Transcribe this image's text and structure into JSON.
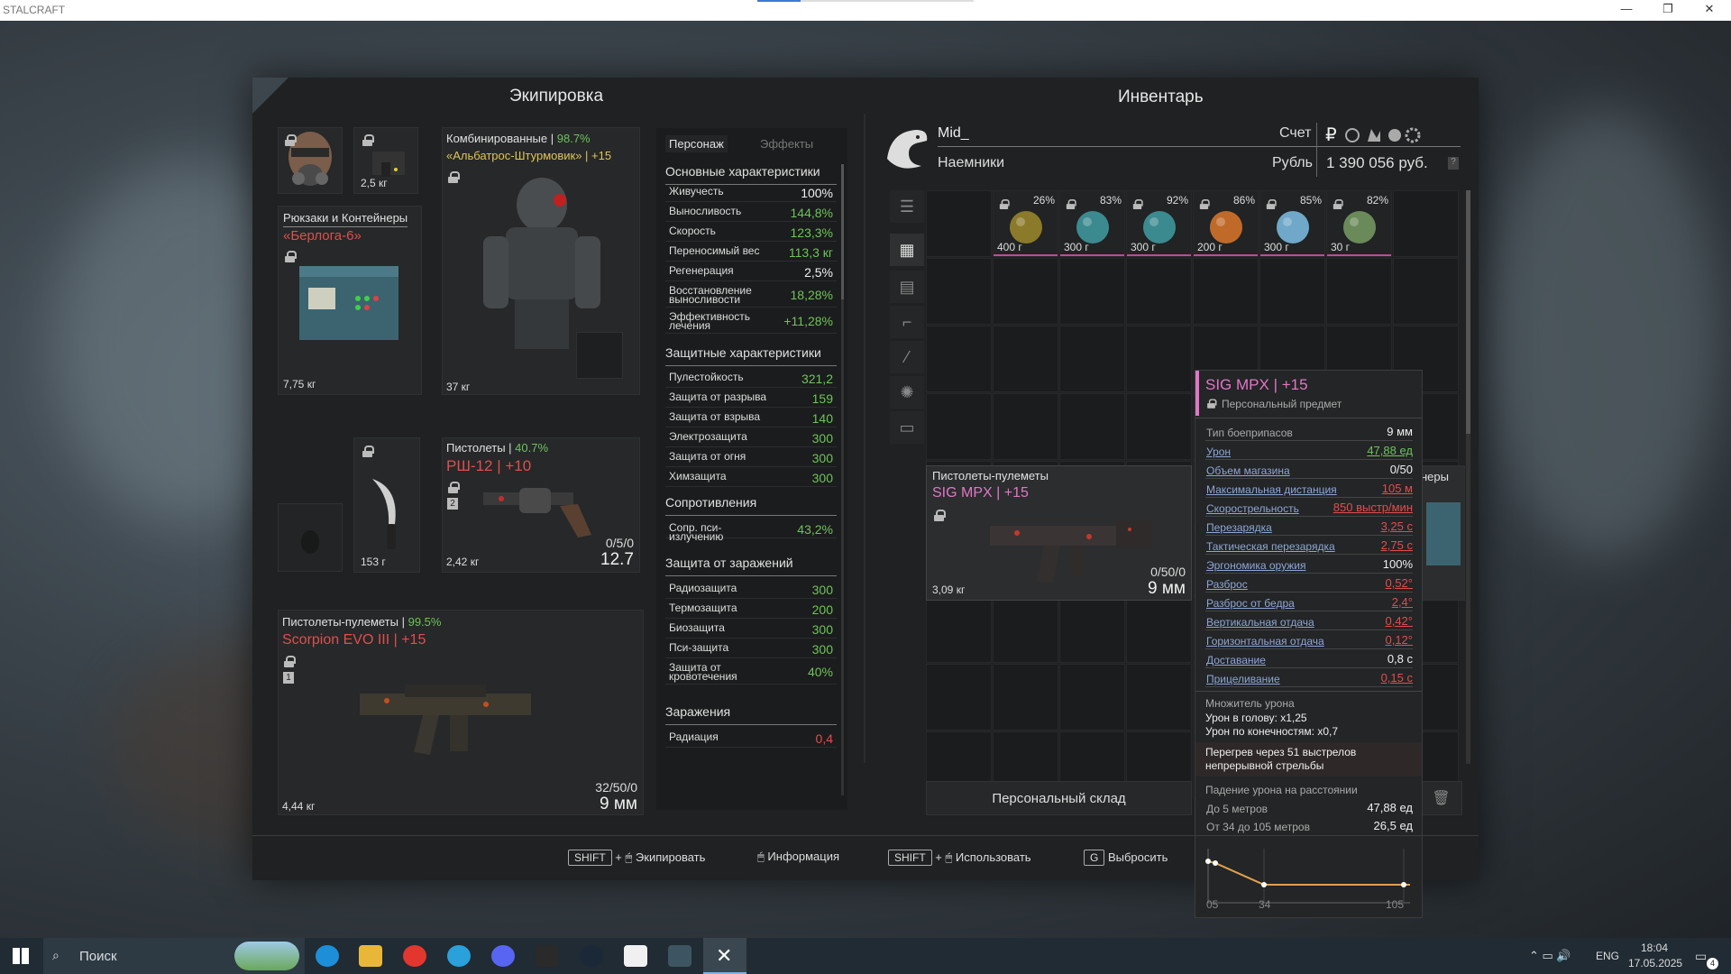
{
  "window": {
    "title": "STALCRAFT"
  },
  "equipment": {
    "header": "Экипировка",
    "mask": {},
    "device": {
      "weight": "2,5 кг"
    },
    "backpack": {
      "category": "Рюкзаки и Контейнеры",
      "name": "«Берлога-6»",
      "weight": "7,75 кг"
    },
    "armor": {
      "category": "Комбинированные |",
      "condition": "98.7%",
      "name": "«Альбатрос-Штурмовик» | +15",
      "weight": "37 кг"
    },
    "knife": {
      "weight": "153 г"
    },
    "pistol": {
      "category": "Пистолеты |",
      "condition": "40.7%",
      "name": "РШ-12 | +10",
      "weight": "2,42 кг",
      "ammo": "0/5/0",
      "caliber": "12.7",
      "slot": "2"
    },
    "smg": {
      "category": "Пистолеты-пулеметы |",
      "condition": "99.5%",
      "name": "Scorpion EVO III | +15",
      "weight": "4,44 кг",
      "ammo": "32/50/0",
      "caliber": "9 мм",
      "slot": "1"
    }
  },
  "stats": {
    "tabs": [
      "Персонаж",
      "Эффекты"
    ],
    "basic": {
      "title": "Основные характеристики",
      "rows": [
        {
          "label": "Живучесть",
          "value": "100%",
          "c": "wh"
        },
        {
          "label": "Выносливость",
          "value": "144,8%",
          "c": "g"
        },
        {
          "label": "Скорость",
          "value": "123,3%",
          "c": "g"
        },
        {
          "label": "Переносимый вес",
          "value": "113,3 кг",
          "c": "g"
        },
        {
          "label": "Регенерация",
          "value": "2,5%",
          "c": "wh"
        },
        {
          "label": "Восстановление выносливости",
          "value": "18,28%",
          "c": "g"
        },
        {
          "label": "Эффективность лечения",
          "value": "+11,28%",
          "c": "g"
        }
      ]
    },
    "defense": {
      "title": "Защитные характеристики",
      "rows": [
        {
          "label": "Пулестойкость",
          "value": "321,2",
          "c": "g"
        },
        {
          "label": "Защита от разрыва",
          "value": "159",
          "c": "g"
        },
        {
          "label": "Защита от взрыва",
          "value": "140",
          "c": "g"
        },
        {
          "label": "Электрозащита",
          "value": "300",
          "c": "g"
        },
        {
          "label": "Защита от огня",
          "value": "300",
          "c": "g"
        },
        {
          "label": "Химзащита",
          "value": "300",
          "c": "g"
        }
      ]
    },
    "resist": {
      "title": "Сопротивления",
      "rows": [
        {
          "label": "Сопр. пси-излучению",
          "value": "43,2%",
          "c": "g"
        }
      ]
    },
    "contam": {
      "title": "Защита от заражений",
      "rows": [
        {
          "label": "Радиозащита",
          "value": "300",
          "c": "g"
        },
        {
          "label": "Термозащита",
          "value": "200",
          "c": "g"
        },
        {
          "label": "Биозащита",
          "value": "300",
          "c": "g"
        },
        {
          "label": "Пси-защита",
          "value": "300",
          "c": "g"
        },
        {
          "label": "Защита от кровотечения",
          "value": "40%",
          "c": "g"
        }
      ]
    },
    "infect": {
      "title": "Заражения",
      "rows": [
        {
          "label": "Радиация",
          "value": "0,4",
          "c": "r"
        }
      ]
    }
  },
  "inventory": {
    "header": "Инвентарь",
    "player": "Mid_",
    "faction": "Наемники",
    "account_label": "Счет",
    "currency_label": "Рубль",
    "balance": "1 390 056 руб.",
    "currency_symbol": "₽",
    "items": [
      {
        "pct": "26%",
        "weight": "400 г",
        "color": "#8a7a2a"
      },
      {
        "pct": "83%",
        "weight": "300 г",
        "color": "#3b8a8f"
      },
      {
        "pct": "92%",
        "weight": "300 г",
        "color": "#3b8a8f"
      },
      {
        "pct": "86%",
        "weight": "200 г",
        "color": "#c06a2a"
      },
      {
        "pct": "85%",
        "weight": "300 г",
        "color": "#6fa8c9"
      },
      {
        "pct": "82%",
        "weight": "30 г",
        "color": "#6a8a5a"
      }
    ],
    "smg_card": {
      "category": "Пистолеты-пулеметы",
      "name": "SIG MPX | +15",
      "weight": "3,09 кг",
      "ammo": "0/50/0",
      "caliber": "9 мм"
    },
    "partial_label": "неры",
    "storage_button": "Персональный склад"
  },
  "tooltip": {
    "name": "SIG MPX | +15",
    "personal": "Персональный предмет",
    "rows": [
      {
        "label": "Тип боеприпасов",
        "value": "9 мм",
        "c": "wh",
        "plain": true
      },
      {
        "label": "Урон",
        "value": "47,88 ед",
        "c": "g"
      },
      {
        "label": "Объем магазина",
        "value": "0/50",
        "c": "wh"
      },
      {
        "label": "Максимальная дистанция",
        "value": "105 м",
        "c": "r"
      },
      {
        "label": "Скорострельность",
        "value": "850 выстр/мин",
        "c": "r"
      },
      {
        "label": "Перезарядка",
        "value": "3,25 с",
        "c": "r"
      },
      {
        "label": "Тактическая перезарядка",
        "value": "2,75 с",
        "c": "r"
      },
      {
        "label": "Эргономика оружия",
        "value": "100%",
        "c": "wh"
      },
      {
        "label": "Разброс",
        "value": "0,52°",
        "c": "r"
      },
      {
        "label": "Разброс от бедра",
        "value": "2,4°",
        "c": "r"
      },
      {
        "label": "Вертикальная отдача",
        "value": "0,42°",
        "c": "r"
      },
      {
        "label": "Горизонтальная отдача",
        "value": "0,12°",
        "c": "r"
      },
      {
        "label": "Доставание",
        "value": "0,8 с",
        "c": "wh"
      },
      {
        "label": "Прицеливание",
        "value": "0,15 с",
        "c": "r"
      }
    ],
    "mult_title": "Множитель урона",
    "head": "Урон в голову: x1,25",
    "limbs": "Урон по конечностям: x0,7",
    "overheat": "Перегрев через 51 выстрелов непрерывной стрельбы",
    "falloff_title": "Падение урона на расстоянии",
    "falloff1_label": "До 5 метров",
    "falloff1_value": "47,88 ед",
    "falloff2_label": "От 34 до 105 метров",
    "falloff2_value": "26,5 ед",
    "ticks": [
      "05",
      "34",
      "105"
    ]
  },
  "footer": {
    "k1": "SHIFT",
    "a1": "Экипировать",
    "a2": "Информация",
    "k3": "SHIFT",
    "a3": "Использовать",
    "k4": "G",
    "a4": "Выбросить"
  },
  "taskbar": {
    "search": "Поиск",
    "lang": "ENG",
    "time": "18:04",
    "date": "17.05.2025",
    "notif": "4"
  }
}
